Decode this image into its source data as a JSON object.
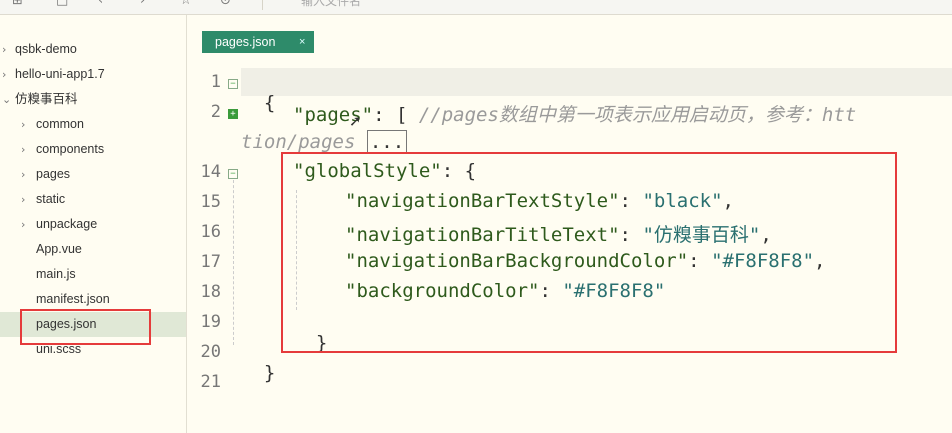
{
  "toolbar": {
    "search_placeholder": "输入文件名",
    "icons": [
      "new-file-icon",
      "save-icon",
      "back-icon",
      "forward-icon",
      "star-icon",
      "run-icon"
    ]
  },
  "sidebar": {
    "items": [
      {
        "label": "qsbk-demo",
        "arrow": "›"
      },
      {
        "label": "hello-uni-app1.7",
        "arrow": "›"
      },
      {
        "label": "仿糗事百科",
        "arrow": "⌄"
      },
      {
        "label": "common",
        "arrow": "›"
      },
      {
        "label": "components",
        "arrow": "›"
      },
      {
        "label": "pages",
        "arrow": "›"
      },
      {
        "label": "static",
        "arrow": "›"
      },
      {
        "label": "unpackage",
        "arrow": "›"
      },
      {
        "label": "App.vue",
        "arrow": ""
      },
      {
        "label": "main.js",
        "arrow": ""
      },
      {
        "label": "manifest.json",
        "arrow": ""
      },
      {
        "label": "pages.json",
        "arrow": ""
      },
      {
        "label": "uni.scss",
        "arrow": ""
      }
    ]
  },
  "tabs": [
    {
      "label": "pages.json",
      "close": "×"
    }
  ],
  "editor": {
    "line_numbers": [
      "1",
      "2",
      "14",
      "15",
      "16",
      "17",
      "18",
      "19",
      "20",
      "21"
    ],
    "lines": {
      "l1": "{",
      "l2_key": "\"pages\"",
      "l2_rest": ": [ ",
      "l2_comment": "//pages数组中第一项表示应用启动页，参考：htt",
      "l2_wrap": "tion/pages",
      "l2_fold": "...",
      "l14_key": "\"globalStyle\"",
      "l14_rest": ": {",
      "l15_key": "\"navigationBarTextStyle\"",
      "l15_val": "\"black\"",
      "l16_key": "\"navigationBarTitleText\"",
      "l16_val": "\"仿糗事百科\"",
      "l17_key": "\"navigationBarBackgroundColor\"",
      "l17_val": "\"#F8F8F8\"",
      "l18_key": "\"backgroundColor\"",
      "l18_val": "\"#F8F8F8\"",
      "l19": "}",
      "l20": "}",
      "colon": ": ",
      "comma": ","
    }
  },
  "colors": {
    "accent": "#2e8b6a",
    "annotation_red": "#e53b3b",
    "key": "#2e5a1c",
    "string": "#2a7070"
  }
}
